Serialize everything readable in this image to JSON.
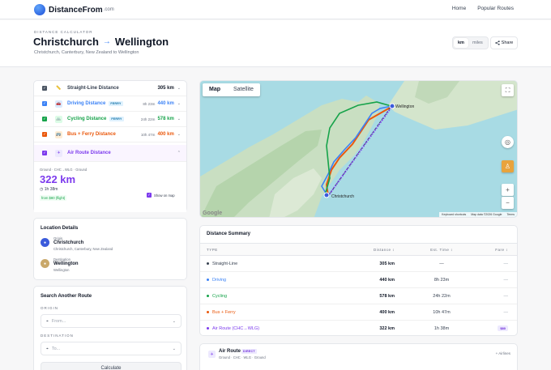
{
  "nav": {
    "logo_name": "DistanceFrom",
    "logo_suffix": ".com",
    "links": [
      "Home",
      "Popular Routes"
    ]
  },
  "header": {
    "eyebrow": "DISTANCE CALCULATOR",
    "origin": "Christchurch",
    "destination": "Wellington",
    "subtitle": "Christchurch, Canterbury, New Zealand to Wellington",
    "units": [
      "km",
      "miles"
    ],
    "active_unit": "km",
    "share_label": "Share"
  },
  "routes": [
    {
      "name": "Straight-Line Distance",
      "icon": "ruler-icon",
      "time": "",
      "badge": "",
      "distance": "305 km",
      "color": "#4b5563",
      "checked": true
    },
    {
      "name": "Driving Distance",
      "icon": "car-icon",
      "time": "8h 23m",
      "badge": "FERRY",
      "distance": "440 km",
      "color": "#3b82f6",
      "checked": true
    },
    {
      "name": "Cycling Distance",
      "icon": "bike-icon",
      "time": "24h 22m",
      "badge": "FERRY",
      "distance": "578 km",
      "color": "#16a34a",
      "checked": true
    },
    {
      "name": "Bus + Ferry Distance",
      "icon": "bus-icon",
      "time": "10h 47m",
      "badge": "",
      "distance": "400 km",
      "color": "#ea580c",
      "checked": true
    },
    {
      "name": "Air Route Distance",
      "icon": "plane-icon",
      "time": "",
      "badge": "",
      "distance": "",
      "color": "#7c3aed",
      "checked": true
    }
  ],
  "air_detail": {
    "path": "Ground · CHC→WLG · Ground",
    "distance": "322 km",
    "duration": "1h 38m",
    "from_price": "from $80 (flight)",
    "show_on_map": "Show on map"
  },
  "location": {
    "title": "Location Details",
    "origin_label": "Origin",
    "origin_name": "Christchurch",
    "origin_detail": "Christchurch, Canterbury, New Zealand",
    "dest_label": "Destination",
    "dest_name": "Wellington",
    "dest_detail": "Wellington"
  },
  "search": {
    "title": "Search Another Route",
    "origin_label": "ORIGIN",
    "origin_placeholder": "From...",
    "destination_label": "DESTINATION",
    "destination_placeholder": "To...",
    "button": "Calculate"
  },
  "map": {
    "tabs": [
      "Map",
      "Satellite"
    ],
    "active_tab": "Map",
    "labels": {
      "christchurch": "Christchurch",
      "wellington": "Wellington",
      "google": "Google"
    },
    "attribution": [
      "Keyboard shortcuts",
      "Map data ©2026 Google",
      "Terms"
    ]
  },
  "summary": {
    "title": "Distance Summary",
    "columns": [
      "TYPE",
      "Distance ↕",
      "Est. Time ↕",
      "Fare ↕"
    ],
    "rows": [
      {
        "type": "Straight-Line",
        "distance": "305 km",
        "time": "—",
        "fare": "—",
        "color": "#374151"
      },
      {
        "type": "Driving",
        "distance": "440 km",
        "time": "8h 23m",
        "fare": "—",
        "color": "#3b82f6"
      },
      {
        "type": "Cycling",
        "distance": "578 km",
        "time": "24h 22m",
        "fare": "—",
        "color": "#16a34a"
      },
      {
        "type": "Bus + Ferry",
        "distance": "400 km",
        "time": "10h 47m",
        "fare": "—",
        "color": "#ea580c"
      },
      {
        "type": "Air Route (CHC→WLG)",
        "distance": "322 km",
        "time": "1h 38m",
        "fare": "$80",
        "color": "#7c3aed"
      }
    ]
  },
  "air_card": {
    "title": "Air Route",
    "badge": "DIRECT",
    "path": "Ground · CHC · WLG · Ground",
    "action": "+ Airlines"
  }
}
